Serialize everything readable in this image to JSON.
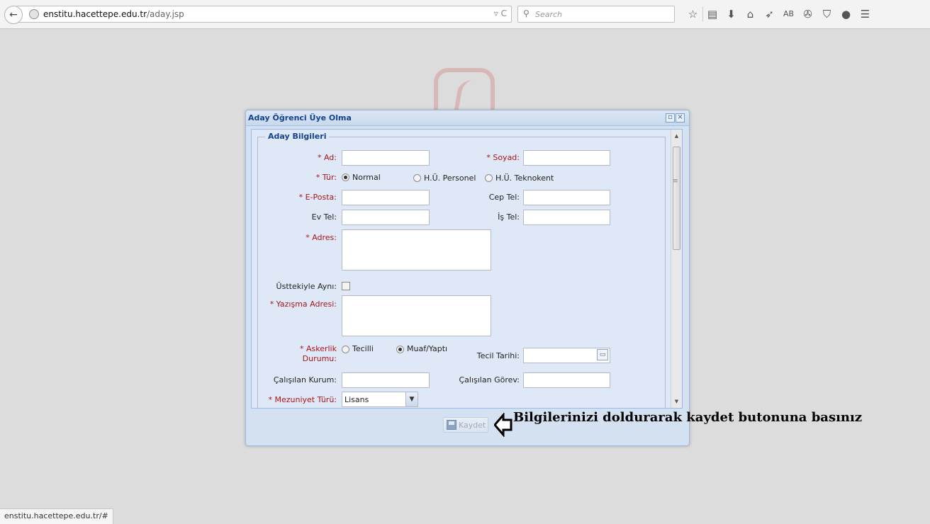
{
  "browser": {
    "url_host": "enstitu.hacettepe.edu.tr",
    "url_path": "/aday.jsp",
    "reload_glyph": "▿ C",
    "search_placeholder": "Search",
    "toolbar_icons": [
      "star-icon",
      "reading-list-icon",
      "download-icon",
      "home-icon",
      "send-icon",
      "ab-icon",
      "extension-icon",
      "shield-icon",
      "chat-icon",
      "menu-icon"
    ],
    "ab_label": "AB"
  },
  "dialog": {
    "title": "Aday Öğrenci Üye Olma",
    "fieldset_title": "Aday Bilgileri",
    "fields": {
      "ad": {
        "label": "* Ad:",
        "value": ""
      },
      "soyad": {
        "label": "* Soyad:",
        "value": ""
      },
      "tur": {
        "label": "* Tür:",
        "options": [
          "Normal",
          "H.Ü. Personel",
          "H.Ü. Teknokent"
        ],
        "selected": "Normal"
      },
      "eposta": {
        "label": "* E-Posta:",
        "value": ""
      },
      "cep_tel": {
        "label": "Cep Tel:",
        "value": ""
      },
      "ev_tel": {
        "label": "Ev Tel:",
        "value": ""
      },
      "is_tel": {
        "label": "İş Tel:",
        "value": ""
      },
      "adres": {
        "label": "* Adres:",
        "value": ""
      },
      "usttekiyle_ayni": {
        "label": "Üsttekiyle Aynı:",
        "checked": false
      },
      "yazisma_adresi": {
        "label": "* Yazışma Adresi:",
        "value": ""
      },
      "askerlik": {
        "label_line1": "* Askerlik",
        "label_line2": "Durumu:",
        "options": [
          "Tecilli",
          "Muaf/Yaptı"
        ],
        "selected": "Muaf/Yaptı"
      },
      "tecil_tarihi": {
        "label": "Tecil Tarihi:",
        "value": ""
      },
      "calisilan_kurum": {
        "label": "Çalışılan Kurum:",
        "value": ""
      },
      "calisilan_gorev": {
        "label": "Çalışılan Görev:",
        "value": ""
      },
      "mezuniyet_turu": {
        "label": "* Mezuniyet Türü:",
        "value": "Lisans"
      }
    },
    "save_button": "Kaydet"
  },
  "annotation": "Bilgilerinizi doldurarak kaydet butonuna basınız",
  "status_bar": "enstitu.hacettepe.edu.tr/#",
  "colors": {
    "required_label": "#a8141b",
    "window_header": "#15428b",
    "panel_background": "#dfe8f6"
  }
}
